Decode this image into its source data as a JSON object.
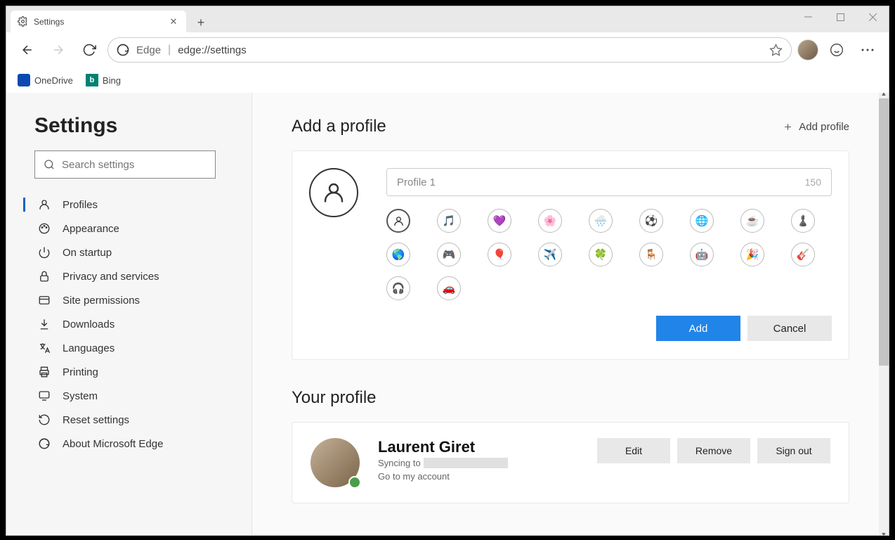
{
  "tab": {
    "title": "Settings"
  },
  "address": {
    "prefix": "Edge",
    "url": "edge://settings"
  },
  "favorites": [
    {
      "name": "OneDrive"
    },
    {
      "name": "Bing",
      "letter": "b"
    }
  ],
  "sidebar": {
    "title": "Settings",
    "search_placeholder": "Search settings",
    "items": [
      {
        "label": "Profiles"
      },
      {
        "label": "Appearance"
      },
      {
        "label": "On startup"
      },
      {
        "label": "Privacy and services"
      },
      {
        "label": "Site permissions"
      },
      {
        "label": "Downloads"
      },
      {
        "label": "Languages"
      },
      {
        "label": "Printing"
      },
      {
        "label": "System"
      },
      {
        "label": "Reset settings"
      },
      {
        "label": "About Microsoft Edge"
      }
    ]
  },
  "add_profile": {
    "heading": "Add a profile",
    "link": "Add profile",
    "name_placeholder": "Profile 1",
    "limit": "150",
    "add_btn": "Add",
    "cancel_btn": "Cancel",
    "icons": [
      "person",
      "music",
      "heart",
      "flower",
      "cloud",
      "soccer",
      "globe",
      "coffee",
      "chess",
      "earth",
      "gamepad",
      "balloons",
      "plane",
      "leaf",
      "chair",
      "robot",
      "party",
      "guitar",
      "headphones",
      "car"
    ]
  },
  "your_profile": {
    "heading": "Your profile",
    "name": "Laurent Giret",
    "sync_label": "Syncing to",
    "goto": "Go to my account",
    "edit": "Edit",
    "remove": "Remove",
    "signout": "Sign out"
  }
}
